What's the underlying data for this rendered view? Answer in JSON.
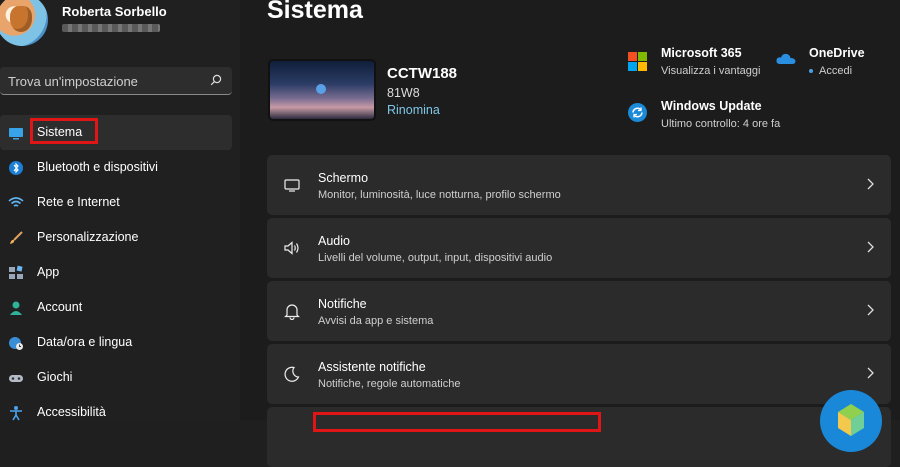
{
  "user": {
    "name": "Roberta Sorbello"
  },
  "search": {
    "placeholder": "Trova un'impostazione"
  },
  "nav": {
    "items": [
      {
        "label": "Sistema",
        "icon": "monitor-icon",
        "active": true
      },
      {
        "label": "Bluetooth e dispositivi",
        "icon": "bluetooth-icon"
      },
      {
        "label": "Rete e Internet",
        "icon": "wifi-icon"
      },
      {
        "label": "Personalizzazione",
        "icon": "brush-icon"
      },
      {
        "label": "App",
        "icon": "apps-icon"
      },
      {
        "label": "Account",
        "icon": "person-icon"
      },
      {
        "label": "Data/ora e lingua",
        "icon": "globe-clock-icon"
      },
      {
        "label": "Giochi",
        "icon": "gamepad-icon"
      },
      {
        "label": "Accessibilità",
        "icon": "accessibility-icon"
      }
    ]
  },
  "main": {
    "title": "Sistema",
    "device": {
      "name": "CCTW188",
      "model": "81W8",
      "rename_label": "Rinomina"
    },
    "tiles": {
      "microsoft365": {
        "title": "Microsoft 365",
        "subtitle": "Visualizza i vantaggi"
      },
      "onedrive": {
        "title": "OneDrive",
        "subtitle": "Accedi"
      },
      "windows_update": {
        "title": "Windows Update",
        "subtitle": "Ultimo controllo: 4 ore fa"
      }
    },
    "cards": [
      {
        "title": "Schermo",
        "subtitle": "Monitor, luminosità, luce notturna, profilo schermo",
        "icon": "display-icon"
      },
      {
        "title": "Audio",
        "subtitle": "Livelli del volume, output, input, dispositivi audio",
        "icon": "speaker-icon"
      },
      {
        "title": "Notifiche",
        "subtitle": "Avvisi da app e sistema",
        "icon": "bell-icon"
      },
      {
        "title": "Assistente notifiche",
        "subtitle": "Notifiche, regole automatiche",
        "icon": "moon-icon"
      }
    ]
  },
  "colors": {
    "highlight": "#e01515",
    "accent": "#7fc7e8",
    "background": "#1c1c1c"
  }
}
